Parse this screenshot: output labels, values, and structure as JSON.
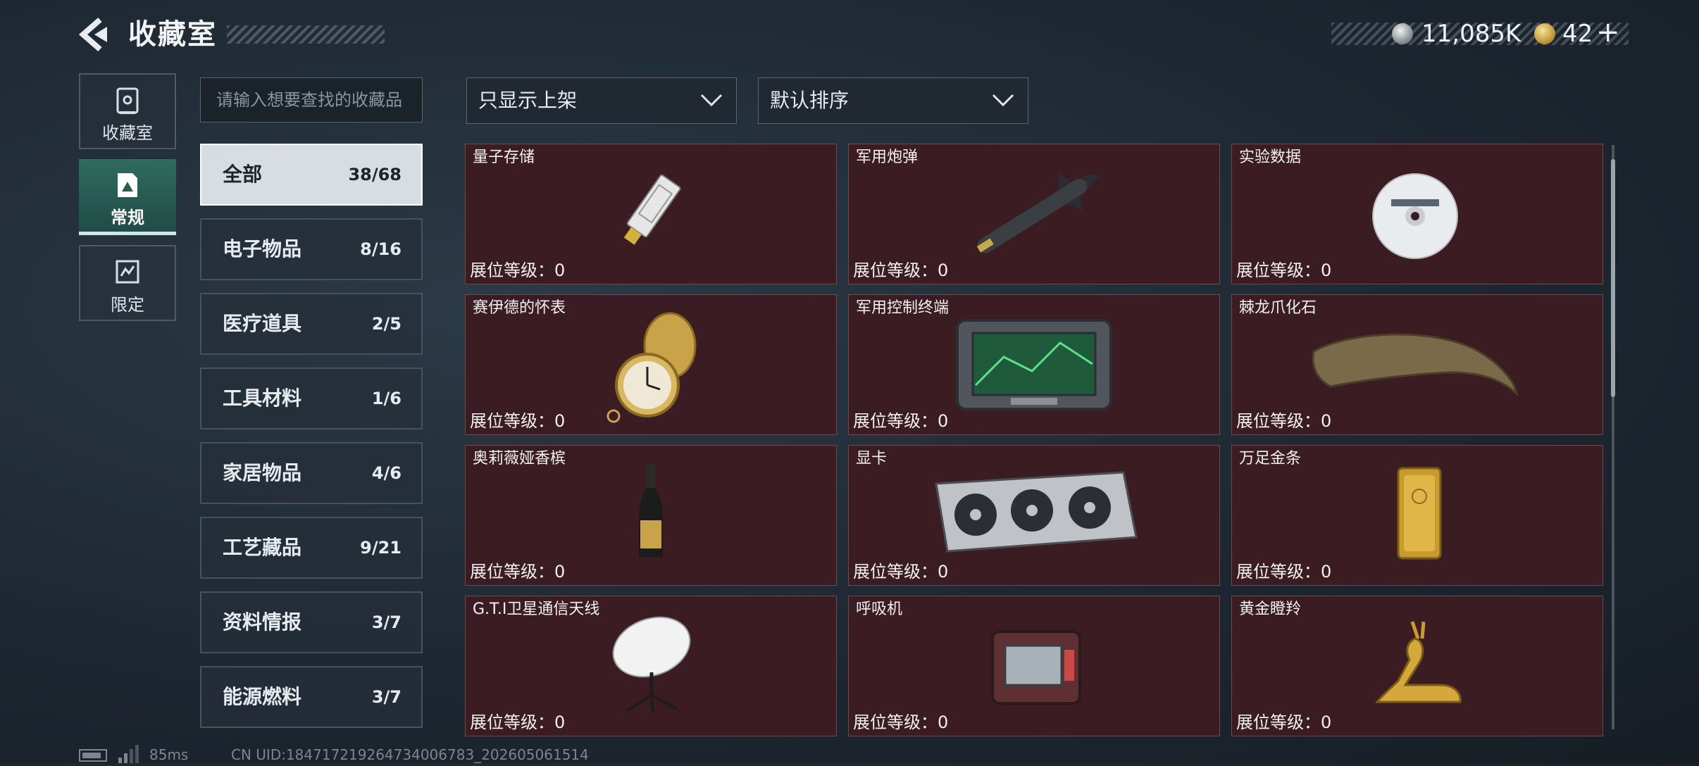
{
  "header": {
    "title": "收藏室"
  },
  "currency": {
    "silver": "11,085K",
    "gold": "42",
    "add_label": "+"
  },
  "nav": {
    "collection_label": "收藏室",
    "regular_label": "常规",
    "limited_label": "限定"
  },
  "search": {
    "placeholder": "请输入想要查找的收藏品"
  },
  "filters": {
    "display": "只显示上架",
    "sort": "默认排序"
  },
  "categories": [
    {
      "name": "全部",
      "count": "38/68",
      "active": true
    },
    {
      "name": "电子物品",
      "count": "8/16"
    },
    {
      "name": "医疗道具",
      "count": "2/5"
    },
    {
      "name": "工具材料",
      "count": "1/6"
    },
    {
      "name": "家居物品",
      "count": "4/6"
    },
    {
      "name": "工艺藏品",
      "count": "9/21"
    },
    {
      "name": "资料情报",
      "count": "3/7"
    },
    {
      "name": "能源燃料",
      "count": "3/7"
    }
  ],
  "items": [
    {
      "name": "量子存储",
      "level": "展位等级：0",
      "icon": "usb-drive-icon"
    },
    {
      "name": "军用炮弹",
      "level": "展位等级：0",
      "icon": "missile-icon"
    },
    {
      "name": "实验数据",
      "level": "展位等级：0",
      "icon": "disc-icon"
    },
    {
      "name": "赛伊德的怀表",
      "level": "展位等级：0",
      "icon": "pocket-watch-icon"
    },
    {
      "name": "军用控制终端",
      "level": "展位等级：0",
      "icon": "control-terminal-icon"
    },
    {
      "name": "棘龙爪化石",
      "level": "展位等级：0",
      "icon": "claw-fossil-icon"
    },
    {
      "name": "奥莉薇娅香槟",
      "level": "展位等级：0",
      "icon": "champagne-bottle-icon"
    },
    {
      "name": "显卡",
      "level": "展位等级：0",
      "icon": "graphics-card-icon"
    },
    {
      "name": "万足金条",
      "level": "展位等级：0",
      "icon": "gold-bar-icon"
    },
    {
      "name": "G.T.I卫星通信天线",
      "level": "展位等级：0",
      "icon": "satellite-dish-icon"
    },
    {
      "name": "呼吸机",
      "level": "展位等级：0",
      "icon": "ventilator-icon"
    },
    {
      "name": "黄金瞪羚",
      "level": "展位等级：0",
      "icon": "gold-gazelle-icon"
    }
  ],
  "status": {
    "ping": "85ms",
    "uid": "CN UID:18471721926473400678​3_202605061514"
  },
  "colors": {
    "card_bg": "#3b1c22",
    "active_nav": "#2f6b60",
    "gold": "#c49a3a"
  }
}
